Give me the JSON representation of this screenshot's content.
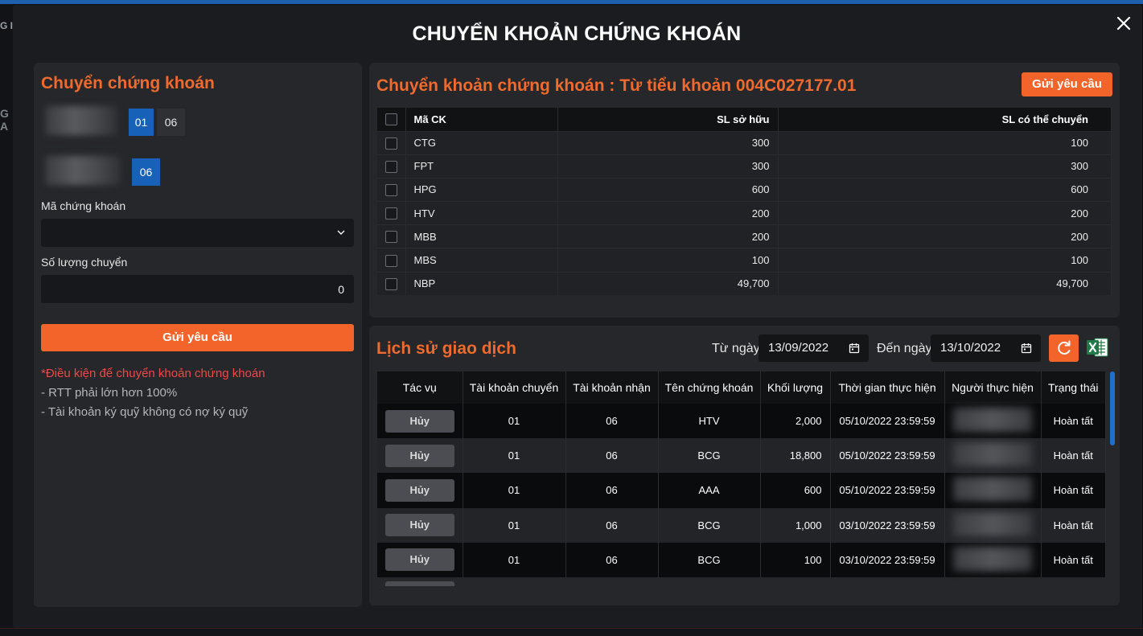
{
  "modal": {
    "title": "CHUYỂN KHOẢN CHỨNG KHOÁN"
  },
  "background": {
    "left_text_1": "G I",
    "left_text_2": "G A"
  },
  "left_panel": {
    "title": "Chuyển chứng khoán",
    "from_accounts": [
      "01",
      "06"
    ],
    "to_account": "06",
    "stock_label": "Mã chứng khoán",
    "stock_value": "",
    "quantity_label": "Số lượng chuyển",
    "quantity_value": "0",
    "submit_label": "Gửi yêu cầu",
    "conditions_title": "*Điều kiện để chuyển khoản chứng khoán",
    "conditions": [
      "- RTT phải lớn hơn 100%",
      "- Tài khoản ký quỹ không có nợ ký quỹ"
    ]
  },
  "transfer_panel": {
    "title": "Chuyển khoản chứng khoán : Từ tiểu khoản 004C027177.01",
    "submit_label": "Gửi yêu cầu",
    "columns": [
      "Mã CK",
      "SL sở hữu",
      "SL có thể chuyển"
    ],
    "rows": [
      {
        "code": "CTG",
        "owned": "300",
        "available": "100"
      },
      {
        "code": "FPT",
        "owned": "300",
        "available": "300"
      },
      {
        "code": "HPG",
        "owned": "600",
        "available": "600"
      },
      {
        "code": "HTV",
        "owned": "200",
        "available": "200"
      },
      {
        "code": "MBB",
        "owned": "200",
        "available": "200"
      },
      {
        "code": "MBS",
        "owned": "100",
        "available": "100"
      },
      {
        "code": "NBP",
        "owned": "49,700",
        "available": "49,700"
      }
    ]
  },
  "history_panel": {
    "title": "Lịch sử giao dịch",
    "from_label": "Từ ngày",
    "from_date": "13/09/2022",
    "to_label": "Đến ngày",
    "to_date": "13/10/2022",
    "columns": [
      "Tác vụ",
      "Tài khoản chuyển",
      "Tài khoản nhận",
      "Tên chứng khoán",
      "Khối lượng",
      "Thời gian thực hiện",
      "Người thực hiện",
      "Trạng thái"
    ],
    "rows": [
      {
        "action": "Hủy",
        "from": "01",
        "to": "06",
        "stock": "HTV",
        "volume": "2,000",
        "time": "05/10/2022 23:59:59",
        "status": "Hoàn tất"
      },
      {
        "action": "Hủy",
        "from": "01",
        "to": "06",
        "stock": "BCG",
        "volume": "18,800",
        "time": "05/10/2022 23:59:59",
        "status": "Hoàn tất"
      },
      {
        "action": "Hủy",
        "from": "01",
        "to": "06",
        "stock": "AAA",
        "volume": "600",
        "time": "05/10/2022 23:59:59",
        "status": "Hoàn tất"
      },
      {
        "action": "Hủy",
        "from": "01",
        "to": "06",
        "stock": "BCG",
        "volume": "1,000",
        "time": "03/10/2022 23:59:59",
        "status": "Hoàn tất"
      },
      {
        "action": "Hủy",
        "from": "01",
        "to": "06",
        "stock": "BCG",
        "volume": "100",
        "time": "03/10/2022 23:59:59",
        "status": "Hoàn tất"
      }
    ]
  },
  "icons": {
    "close": "close-icon",
    "chevron": "chevron-down-icon",
    "calendar": "calendar-icon",
    "refresh": "refresh-icon",
    "excel": "excel-icon"
  },
  "colors": {
    "accent": "#f2642a",
    "title_orange": "#ef6a2c",
    "active_blue": "#1762b8",
    "link_blue": "#3d8fe6",
    "status_green": "#23a642",
    "warning_red": "#f04747"
  }
}
